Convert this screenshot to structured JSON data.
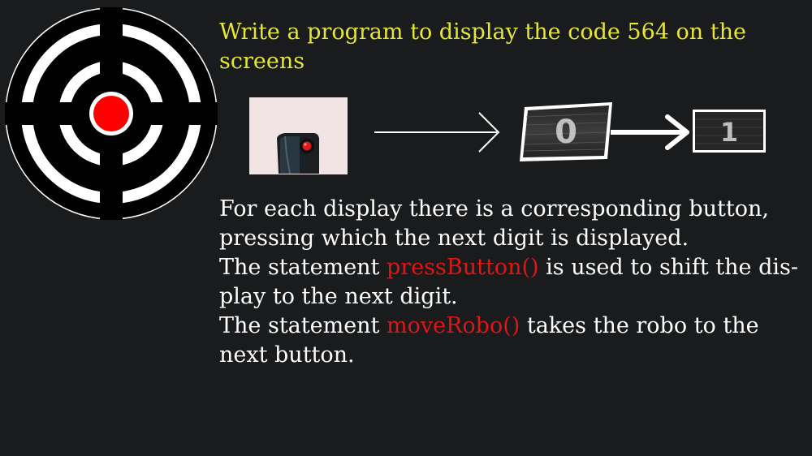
{
  "title": {
    "line1": "Write a program to display the code 564 on the",
    "line2": "screens"
  },
  "icons": {
    "target": "target-icon",
    "robot_button": "robot-button-image",
    "arrow_thin": "arrow-right-icon",
    "display_big": "digit-display-0",
    "arrow_thick": "arrow-right-bold-icon",
    "display_small": "digit-display-1"
  },
  "displays": {
    "big_digit": "0",
    "small_digit": "1"
  },
  "description": {
    "p1_line1": "For each display there is a corresponding button,",
    "p1_line2": "pressing which the next digit is displayed.",
    "p2_prefix": "The statement ",
    "p2_code": "pressButton()",
    "p2_suffix": " is used to shift the dis-",
    "p2_line2": "play to the next digit.",
    "p3_prefix": "The statement ",
    "p3_code": "moveRobo()",
    "p3_suffix": " takes the robo to the",
    "p3_line2": "next button."
  },
  "colors": {
    "background": "#191b1c",
    "title": "#e6e634",
    "body_text": "#ffffff",
    "code": "#e01616",
    "target_center": "#ff0000"
  }
}
